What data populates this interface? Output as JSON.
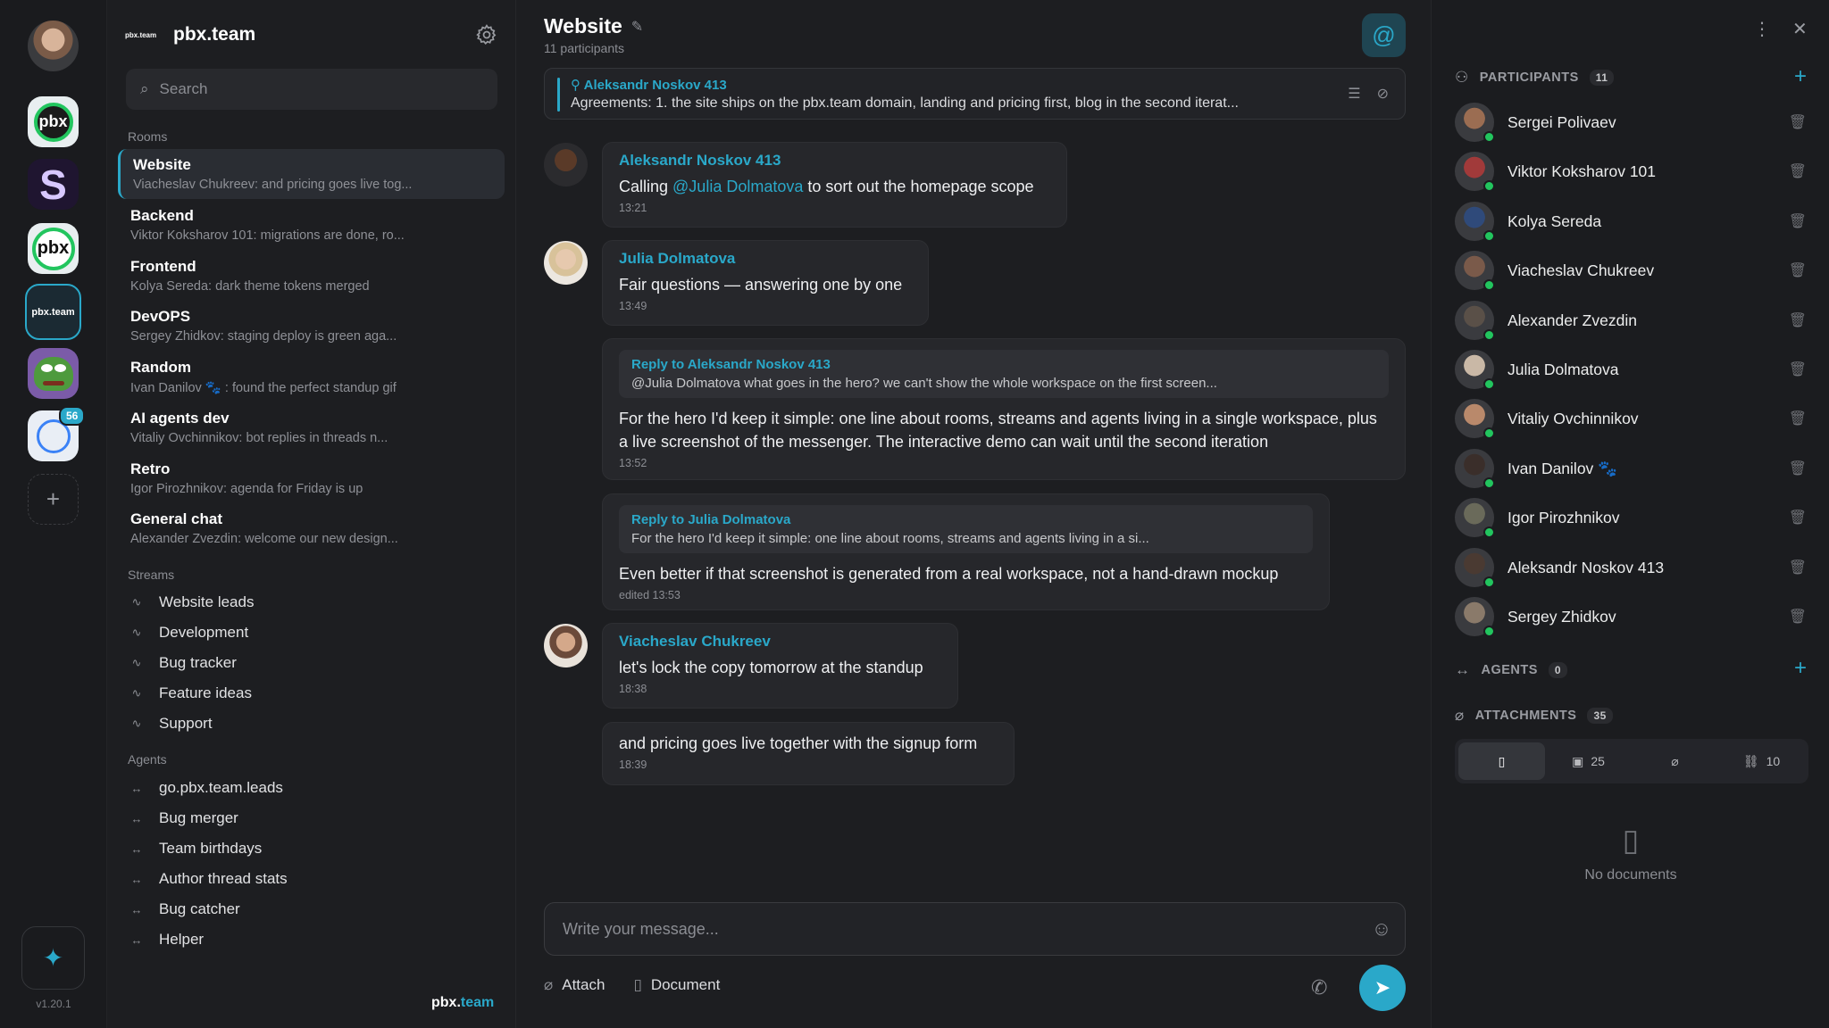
{
  "rail": {
    "workspaces": [
      {
        "name": "pbx"
      },
      {
        "name": "S"
      },
      {
        "name": "pbx"
      },
      {
        "name": "pbx.team",
        "active": true
      },
      {
        "name": "pepe"
      },
      {
        "name": "clock",
        "badge": "56"
      }
    ],
    "version": "v1.20.1"
  },
  "sidebar": {
    "brand": "pbx.team",
    "search_placeholder": "Search",
    "rooms_label": "Rooms",
    "rooms": [
      {
        "name": "Website",
        "preview": "Viacheslav Chukreev: and pricing goes live tog...",
        "active": true
      },
      {
        "name": "Backend",
        "preview": "Viktor Koksharov 101: migrations are done, ro..."
      },
      {
        "name": "Frontend",
        "preview": "Kolya Sereda: dark theme tokens merged"
      },
      {
        "name": "DevOPS",
        "preview": "Sergey Zhidkov: staging deploy is green aga..."
      },
      {
        "name": "Random",
        "preview": "Ivan Danilov 🐾 : found the perfect standup gif"
      },
      {
        "name": "AI agents dev",
        "preview": "Vitaliy Ovchinnikov: bot replies in threads n..."
      },
      {
        "name": "Retro",
        "preview": "Igor Pirozhnikov: agenda for Friday is up"
      },
      {
        "name": "General chat",
        "preview": "Alexander Zvezdin: welcome our new design..."
      }
    ],
    "streams_label": "Streams",
    "streams": [
      "Website leads",
      "Development",
      "Bug tracker",
      "Feature ideas",
      "Support"
    ],
    "agents_label": "Agents",
    "agents": [
      "go.pbx.team.leads",
      "Bug merger",
      "Team birthdays",
      "Author thread stats",
      "Bug catcher",
      "Helper"
    ],
    "footer_brand": "pbx.",
    "footer_brand_accent": "team"
  },
  "chat": {
    "title": "Website",
    "participants_count": "11 participants",
    "pinned": {
      "author": "Aleksandr Noskov 413",
      "text": "Agreements: 1. the site ships on the pbx.team domain, landing and pricing first, blog in the second iterat..."
    },
    "messages": [
      {
        "author": "Aleksandr Noskov 413",
        "pre": "Calling ",
        "mention": "@Julia Dolmatova",
        "post": " to sort out the homepage scope",
        "time": "13:21"
      },
      {
        "author": "Julia Dolmatova",
        "text": "Fair questions — answering one by one",
        "time": "13:49"
      },
      {
        "reply_to": "Reply to Aleksandr Noskov 413",
        "quote": "@Julia Dolmatova what goes in the hero? we can't show the whole workspace on the first screen...",
        "text": "For the hero I'd keep it simple: one line about rooms, streams and agents living in a single workspace, plus a live screenshot of the messenger. The interactive demo can wait until the second iteration",
        "time": "13:52"
      },
      {
        "reply_to": "Reply to Julia Dolmatova",
        "quote": "For the hero I'd keep it simple: one line about rooms, streams and agents living in a si...",
        "text": "Even better if that screenshot is generated from a real workspace, not a hand-drawn mockup",
        "time": "edited 13:53"
      },
      {
        "author": "Viacheslav Chukreev",
        "text": "let's lock the copy tomorrow at the standup",
        "time": "18:38"
      },
      {
        "text": "and pricing goes live together with the signup form",
        "time": "18:39"
      }
    ],
    "composer_placeholder": "Write your message...",
    "attach_label": "Attach",
    "document_label": "Document"
  },
  "panel": {
    "participants_label": "PARTICIPANTS",
    "participants_count": "11",
    "participants": [
      {
        "name": "Sergei Polivaev",
        "color": "#9b6d52"
      },
      {
        "name": "Viktor Koksharov 101",
        "color": "#a13a3a"
      },
      {
        "name": "Kolya Sereda",
        "color": "#2f4a7a"
      },
      {
        "name": "Viacheslav Chukreev",
        "color": "#7a5a4a"
      },
      {
        "name": "Alexander Zvezdin",
        "color": "#5a5048"
      },
      {
        "name": "Julia Dolmatova",
        "color": "#c9b8a6"
      },
      {
        "name": "Vitaliy Ovchinnikov",
        "color": "#b9896b"
      },
      {
        "name": "Ivan Danilov 🐾",
        "color": "#3a2e2a"
      },
      {
        "name": "Igor Pirozhnikov",
        "color": "#6a6a5a"
      },
      {
        "name": "Aleksandr Noskov 413",
        "color": "#4a3a32"
      },
      {
        "name": "Sergey Zhidkov",
        "color": "#8a7a6a"
      }
    ],
    "agents_label": "AGENTS",
    "agents_count": "0",
    "attachments_label": "ATTACHMENTS",
    "attachments_count": "35",
    "tabs": [
      {
        "icon": "document-icon",
        "count": ""
      },
      {
        "icon": "image-icon",
        "count": "25"
      },
      {
        "icon": "paperclip-icon",
        "count": ""
      },
      {
        "icon": "link-icon",
        "count": "10"
      }
    ],
    "empty_text": "No documents"
  }
}
